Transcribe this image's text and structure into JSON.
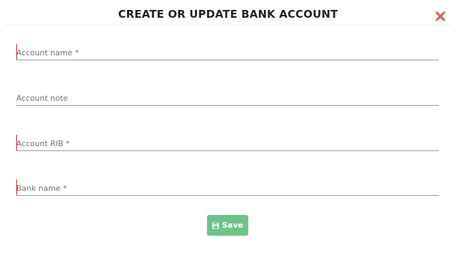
{
  "dialog": {
    "title": "CREATE OR UPDATE BANK ACCOUNT"
  },
  "fields": {
    "account_name": {
      "placeholder": "Account name *",
      "value": ""
    },
    "account_note": {
      "placeholder": "Account note",
      "value": ""
    },
    "account_rib": {
      "placeholder": "Account RIB *",
      "value": ""
    },
    "bank_name": {
      "placeholder": "Bank name *",
      "value": ""
    }
  },
  "actions": {
    "save_label": "Save",
    "save_icon": "floppy-disk-icon",
    "close_icon": "close-icon"
  },
  "colors": {
    "close": "#e06060",
    "save_button": "#6cc38b",
    "required_marker": "#cc2b2b"
  }
}
